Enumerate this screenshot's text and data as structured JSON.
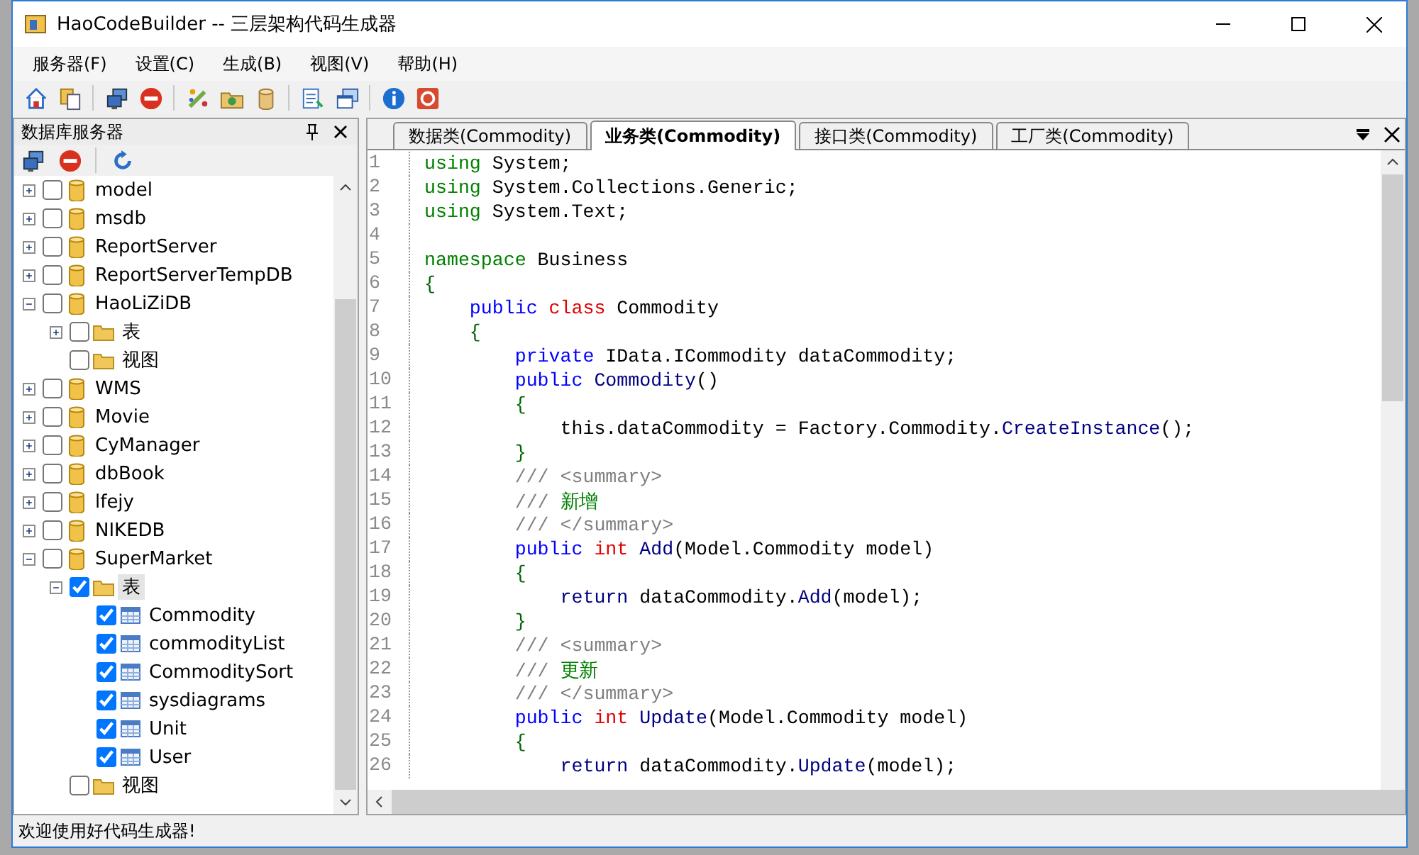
{
  "window": {
    "title": "HaoCodeBuilder -- 三层架构代码生成器"
  },
  "menu": [
    "服务器(F)",
    "设置(C)",
    "生成(B)",
    "视图(V)",
    "帮助(H)"
  ],
  "server_panel": {
    "title": "数据库服务器",
    "tree": [
      {
        "label": "model",
        "kind": "database",
        "expanded": false,
        "checked": false,
        "selected": false
      },
      {
        "label": "msdb",
        "kind": "database",
        "expanded": false,
        "checked": false,
        "selected": false
      },
      {
        "label": "ReportServer",
        "kind": "database",
        "expanded": false,
        "checked": false,
        "selected": false
      },
      {
        "label": "ReportServerTempDB",
        "kind": "database",
        "expanded": false,
        "checked": false,
        "selected": false
      },
      {
        "label": "HaoLiZiDB",
        "kind": "database",
        "expanded": true,
        "checked": false,
        "selected": false,
        "children": [
          {
            "label": "表",
            "kind": "folder",
            "expanded": false,
            "checked": false,
            "selected": false
          },
          {
            "label": "视图",
            "kind": "folder",
            "checked": false,
            "selected": false
          }
        ]
      },
      {
        "label": "WMS",
        "kind": "database",
        "expanded": false,
        "checked": false,
        "selected": false
      },
      {
        "label": "Movie",
        "kind": "database",
        "expanded": false,
        "checked": false,
        "selected": false
      },
      {
        "label": "CyManager",
        "kind": "database",
        "expanded": false,
        "checked": false,
        "selected": false
      },
      {
        "label": "dbBook",
        "kind": "database",
        "expanded": false,
        "checked": false,
        "selected": false
      },
      {
        "label": "lfejy",
        "kind": "database",
        "expanded": false,
        "checked": false,
        "selected": false
      },
      {
        "label": "NIKEDB",
        "kind": "database",
        "expanded": false,
        "checked": false,
        "selected": false
      },
      {
        "label": "SuperMarket",
        "kind": "database",
        "expanded": true,
        "checked": false,
        "selected": false,
        "children": [
          {
            "label": "表",
            "kind": "folder",
            "expanded": true,
            "checked": true,
            "selected": true,
            "children": [
              {
                "label": "Commodity",
                "kind": "table",
                "checked": true,
                "selected": false
              },
              {
                "label": "commodityList",
                "kind": "table",
                "checked": true,
                "selected": false
              },
              {
                "label": "CommoditySort",
                "kind": "table",
                "checked": true,
                "selected": false
              },
              {
                "label": "sysdiagrams",
                "kind": "table",
                "checked": true,
                "selected": false
              },
              {
                "label": "Unit",
                "kind": "table",
                "checked": true,
                "selected": false
              },
              {
                "label": "User",
                "kind": "table",
                "checked": true,
                "selected": false
              }
            ]
          },
          {
            "label": "视图",
            "kind": "folder",
            "checked": false,
            "selected": false
          }
        ]
      }
    ]
  },
  "editor": {
    "tabs": [
      {
        "label": "数据类(Commodity)",
        "selected": false
      },
      {
        "label": "业务类(Commodity)",
        "selected": true
      },
      {
        "label": "接口类(Commodity)",
        "selected": false
      },
      {
        "label": "工厂类(Commodity)",
        "selected": false
      }
    ],
    "lines": [
      {
        "number": "1",
        "tokens": [
          {
            "kind": "directive",
            "text": "using"
          },
          {
            "kind": "plain",
            "text": " System;"
          }
        ]
      },
      {
        "number": "2",
        "tokens": [
          {
            "kind": "directive",
            "text": "using"
          },
          {
            "kind": "plain",
            "text": " System.Collections.Generic;"
          }
        ]
      },
      {
        "number": "3",
        "tokens": [
          {
            "kind": "directive",
            "text": "using"
          },
          {
            "kind": "plain",
            "text": " System.Text;"
          }
        ]
      },
      {
        "number": "4"
      },
      {
        "number": "5",
        "tokens": [
          {
            "kind": "directive",
            "text": "namespace"
          },
          {
            "kind": "plain",
            "text": " Business"
          }
        ]
      },
      {
        "number": "6",
        "tokens": [
          {
            "kind": "brace",
            "text": "{"
          }
        ]
      },
      {
        "number": "7",
        "tokens": [
          {
            "kind": "keyword",
            "text": "    public "
          },
          {
            "kind": "type",
            "text": "class"
          },
          {
            "kind": "plain",
            "text": " Commodity"
          }
        ]
      },
      {
        "number": "8",
        "tokens": [
          {
            "kind": "brace",
            "text": "    {"
          }
        ]
      },
      {
        "number": "9",
        "tokens": [
          {
            "kind": "keyword",
            "text": "        private"
          },
          {
            "kind": "plain",
            "text": " IData.ICommodity dataCommodity;"
          }
        ]
      },
      {
        "number": "10",
        "tokens": [
          {
            "kind": "keyword",
            "text": "        public "
          },
          {
            "kind": "member",
            "text": "Commodity"
          },
          {
            "kind": "plain",
            "text": "()"
          }
        ]
      },
      {
        "number": "11",
        "tokens": [
          {
            "kind": "brace",
            "text": "        {"
          }
        ]
      },
      {
        "number": "12",
        "tokens": [
          {
            "kind": "self",
            "text": "            this"
          },
          {
            "kind": "plain",
            "text": ".dataCommodity = Factory.Commodity."
          },
          {
            "kind": "member",
            "text": "CreateInstance"
          },
          {
            "kind": "plain",
            "text": "();"
          }
        ]
      },
      {
        "number": "13",
        "tokens": [
          {
            "kind": "brace",
            "text": "        }"
          }
        ]
      },
      {
        "number": "14",
        "tokens": [
          {
            "kind": "doc",
            "text": "        /// <summary>"
          }
        ]
      },
      {
        "number": "15",
        "tokens": [
          {
            "kind": "doc",
            "text": "        /// "
          },
          {
            "kind": "comment",
            "text": "新增"
          }
        ]
      },
      {
        "number": "16",
        "tokens": [
          {
            "kind": "doc",
            "text": "        /// </summary>"
          }
        ]
      },
      {
        "number": "17",
        "tokens": [
          {
            "kind": "keyword",
            "text": "        public "
          },
          {
            "kind": "type",
            "text": "int "
          },
          {
            "kind": "member",
            "text": "Add"
          },
          {
            "kind": "plain",
            "text": "(Model.Commodity model)"
          }
        ]
      },
      {
        "number": "18",
        "tokens": [
          {
            "kind": "brace",
            "text": "        {"
          }
        ]
      },
      {
        "number": "19",
        "tokens": [
          {
            "kind": "member",
            "text": "            return"
          },
          {
            "kind": "plain",
            "text": " dataCommodity."
          },
          {
            "kind": "member",
            "text": "Add"
          },
          {
            "kind": "plain",
            "text": "(model);"
          }
        ]
      },
      {
        "number": "20",
        "tokens": [
          {
            "kind": "brace",
            "text": "        }"
          }
        ]
      },
      {
        "number": "21",
        "tokens": [
          {
            "kind": "doc",
            "text": "        /// <summary>"
          }
        ]
      },
      {
        "number": "22",
        "tokens": [
          {
            "kind": "doc",
            "text": "        /// "
          },
          {
            "kind": "comment",
            "text": "更新"
          }
        ]
      },
      {
        "number": "23",
        "tokens": [
          {
            "kind": "doc",
            "text": "        /// </summary>"
          }
        ]
      },
      {
        "number": "24",
        "tokens": [
          {
            "kind": "keyword",
            "text": "        public "
          },
          {
            "kind": "type",
            "text": "int "
          },
          {
            "kind": "member",
            "text": "Update"
          },
          {
            "kind": "plain",
            "text": "(Model.Commodity model)"
          }
        ]
      },
      {
        "number": "25",
        "tokens": [
          {
            "kind": "brace",
            "text": "        {"
          }
        ]
      },
      {
        "number": "26",
        "tokens": [
          {
            "kind": "member",
            "text": "            return"
          },
          {
            "kind": "plain",
            "text": " dataCommodity."
          },
          {
            "kind": "member",
            "text": "Update"
          },
          {
            "kind": "plain",
            "text": "(model);"
          }
        ]
      }
    ]
  },
  "status_bar": "欢迎使用好代码生成器!"
}
